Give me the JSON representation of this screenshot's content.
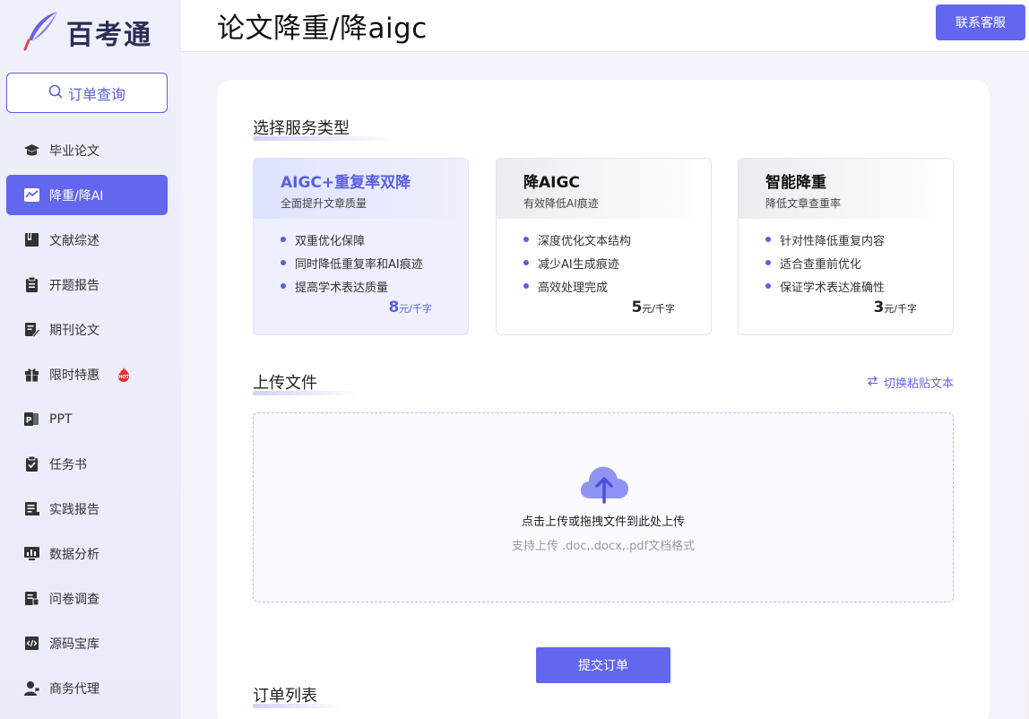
{
  "brand": {
    "name": "百考通",
    "accent": "#6366ee"
  },
  "header": {
    "title": "论文降重/降aigc",
    "contact_label": "联系客服"
  },
  "sidebar": {
    "order_query_label": "订单查询",
    "items": [
      {
        "label": "毕业论文",
        "icon": "graduation-cap-icon",
        "active": false
      },
      {
        "label": "降重/降AI",
        "icon": "trend-chart-icon",
        "active": true
      },
      {
        "label": "文献综述",
        "icon": "book-icon",
        "active": false
      },
      {
        "label": "开题报告",
        "icon": "clipboard-icon",
        "active": false
      },
      {
        "label": "期刊论文",
        "icon": "edit-document-icon",
        "active": false
      },
      {
        "label": "限时特惠",
        "icon": "gift-icon",
        "active": false,
        "badge": "HOT"
      },
      {
        "label": "PPT",
        "icon": "ppt-icon",
        "active": false
      },
      {
        "label": "任务书",
        "icon": "task-clipboard-icon",
        "active": false
      },
      {
        "label": "实践报告",
        "icon": "report-icon",
        "active": false
      },
      {
        "label": "数据分析",
        "icon": "bar-chart-icon",
        "active": false
      },
      {
        "label": "问卷调查",
        "icon": "survey-icon",
        "active": false
      },
      {
        "label": "源码宝库",
        "icon": "code-icon",
        "active": false
      },
      {
        "label": "商务代理",
        "icon": "agent-icon",
        "active": false
      }
    ]
  },
  "main": {
    "service_section_title": "选择服务类型",
    "services": [
      {
        "name": "AIGC+重复率双降",
        "subtitle": "全面提升文章质量",
        "features": [
          "双重优化保障",
          "同时降低重复率和AI痕迹",
          "提高学术表达质量"
        ],
        "price": "8",
        "unit": "元/千字",
        "selected": true
      },
      {
        "name": "降AIGC",
        "subtitle": "有效降低AI痕迹",
        "features": [
          "深度优化文本结构",
          "减少AI生成痕迹",
          "高效处理完成"
        ],
        "price": "5",
        "unit": "元/千字",
        "selected": false
      },
      {
        "name": "智能降重",
        "subtitle": "降低文章查重率",
        "features": [
          "针对性降低重复内容",
          "适合查重前优化",
          "保证学术表达准确性"
        ],
        "price": "3",
        "unit": "元/千字",
        "selected": false
      }
    ],
    "upload_section_title": "上传文件",
    "switch_label": "切换粘贴文本",
    "upload_main": "点击上传或拖拽文件到此处上传",
    "upload_hint": "支持上传 .doc,.docx,.pdf文档格式",
    "submit_label": "提交订单",
    "order_section_title": "订单列表"
  }
}
